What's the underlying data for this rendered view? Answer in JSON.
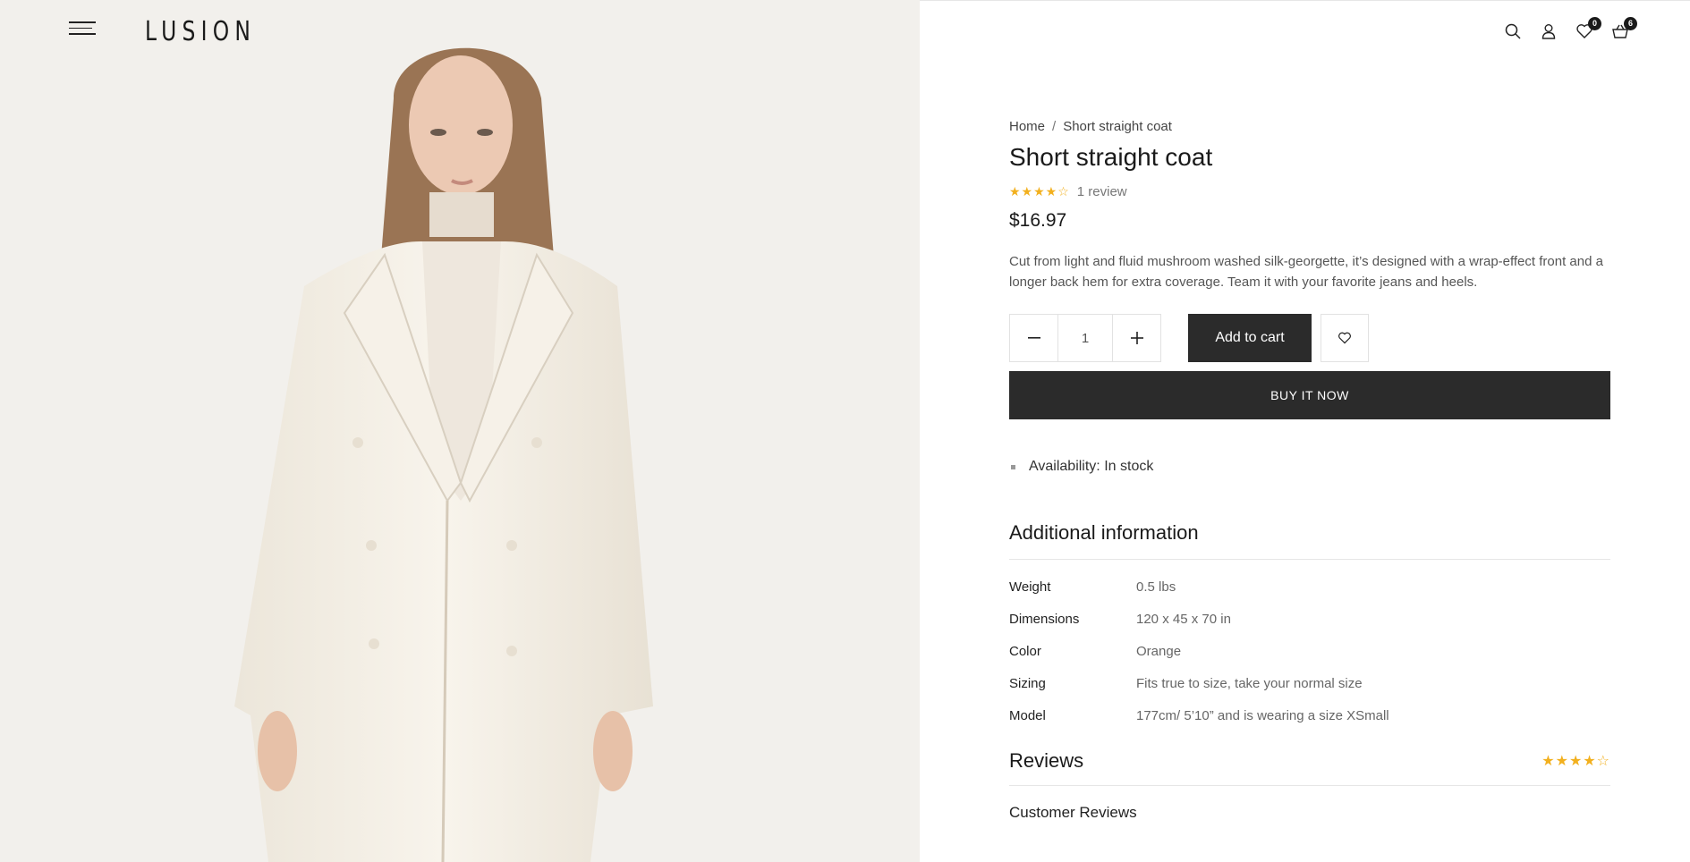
{
  "header": {
    "logo": "LUSION",
    "wishlist_count": "0",
    "cart_count": "6",
    "icons": [
      "hamburger-menu-icon",
      "search-icon",
      "user-icon",
      "heart-icon",
      "basket-icon"
    ]
  },
  "breadcrumb": {
    "home": "Home",
    "separator": "/",
    "current": "Short straight coat"
  },
  "product": {
    "title": "Short straight coat",
    "rating": 4,
    "rating_max": 5,
    "stars_filled": "★★★★",
    "stars_empty": "☆",
    "review_count_label": "1 review",
    "price": "$16.97",
    "description": "Cut from light and fluid mushroom washed silk-georgette, it’s designed with a wrap-effect front and a longer back hem for extra coverage. Team it with your favorite jeans and heels.",
    "quantity": "1",
    "add_to_cart_label": "Add to cart",
    "buy_now_label": "BUY IT NOW",
    "availability_label": "Availability:",
    "availability_value": "In stock"
  },
  "additional_info": {
    "title": "Additional information",
    "rows": [
      {
        "key": "Weight",
        "value": "0.5 lbs"
      },
      {
        "key": "Dimensions",
        "value": "120 x 45 x 70 in"
      },
      {
        "key": "Color",
        "value": "Orange"
      },
      {
        "key": "Sizing",
        "value": "Fits true to size, take your normal size"
      },
      {
        "key": "Model",
        "value": "177cm/ 5’10” and is wearing a size XSmall"
      }
    ]
  },
  "reviews": {
    "title": "Reviews",
    "stars_filled": "★★★★",
    "stars_empty": "☆",
    "customer_reviews_label": "Customer Reviews"
  },
  "colors": {
    "accent_dark": "#2b2b2b",
    "star": "#f2b01e",
    "image_bg": "#f2f0ec"
  }
}
